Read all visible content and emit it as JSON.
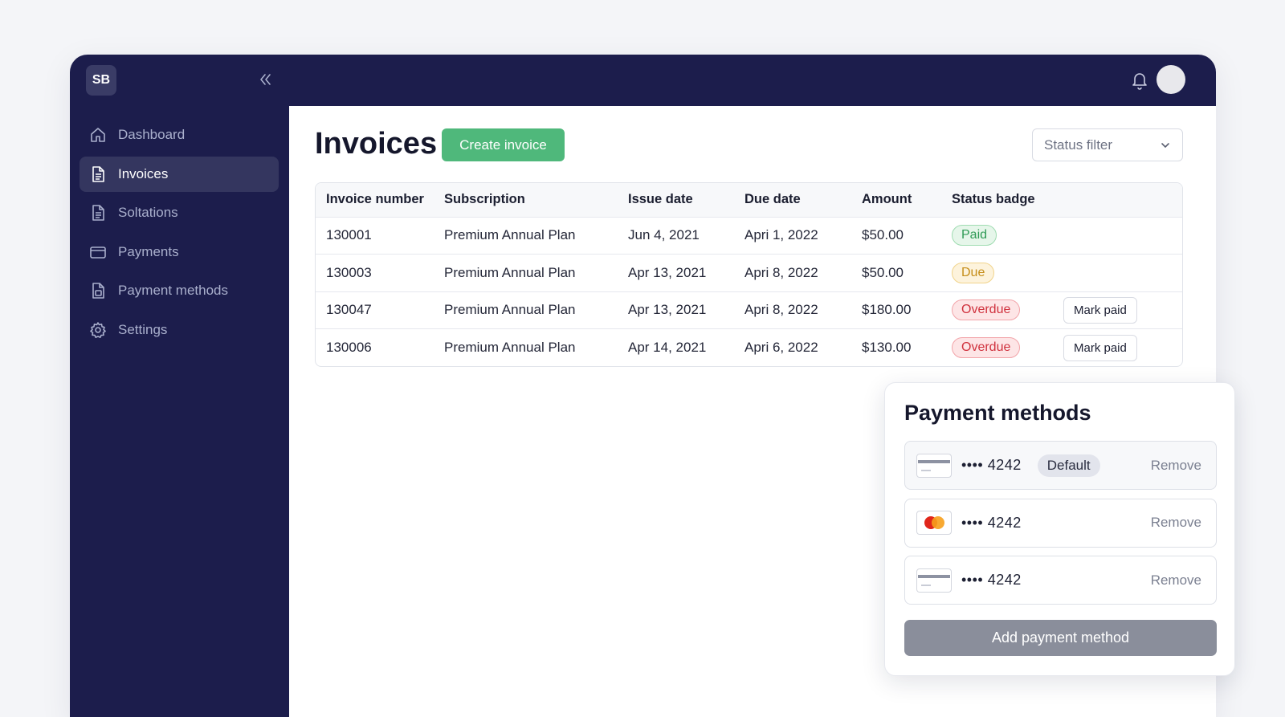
{
  "brand": {
    "initials": "SB"
  },
  "sidebar": {
    "items": [
      {
        "label": "Dashboard",
        "icon": "home-icon"
      },
      {
        "label": "Invoices",
        "icon": "document-icon",
        "active": true
      },
      {
        "label": "Soltations",
        "icon": "document-icon"
      },
      {
        "label": "Payments",
        "icon": "credit-card-icon"
      },
      {
        "label": "Payment methods",
        "icon": "document-icon"
      },
      {
        "label": "Settings",
        "icon": "gear-icon"
      }
    ]
  },
  "header": {
    "title": "Invoices",
    "create_label": "Create invoice",
    "status_filter_placeholder": "Status filter"
  },
  "table": {
    "columns": [
      "Invoice number",
      "Subscription",
      "Issue date",
      "Due date",
      "Amount",
      "Status badge"
    ],
    "rows": [
      {
        "number": "130001",
        "subscription": "Premium Annual Plan",
        "issue": "Jun 4, 2021",
        "due": "Apri 1, 2022",
        "amount": "$50.00",
        "status": "Paid",
        "action": ""
      },
      {
        "number": "130003",
        "subscription": "Premium Annual Plan",
        "issue": "Apr 13, 2021",
        "due": "Apri 8, 2022",
        "amount": "$50.00",
        "status": "Due",
        "action": ""
      },
      {
        "number": "130047",
        "subscription": "Premium Annual Plan",
        "issue": "Apr 13, 2021",
        "due": "Apri 8, 2022",
        "amount": "$180.00",
        "status": "Overdue",
        "action": "Mark paid"
      },
      {
        "number": "130006",
        "subscription": "Premium Annual Plan",
        "issue": "Apr 14, 2021",
        "due": "Apri 6, 2022",
        "amount": "$130.00",
        "status": "Overdue",
        "action": "Mark paid"
      }
    ]
  },
  "payment_methods": {
    "title": "Payment methods",
    "items": [
      {
        "masked": "•••• 4242",
        "brand_icon": "generic-card-icon",
        "default_label": "Default",
        "remove_label": "Remove"
      },
      {
        "masked": "•••• 4242",
        "brand_icon": "mastercard-icon",
        "default_label": "",
        "remove_label": "Remove"
      },
      {
        "masked": "•••• 4242",
        "brand_icon": "generic-card-icon",
        "default_label": "",
        "remove_label": "Remove"
      }
    ],
    "add_label": "Add payment method"
  },
  "colors": {
    "sidebar_bg": "#1c1d4c",
    "accent_green": "#4fb87b",
    "paid": "#2e9a55",
    "due": "#c58d18",
    "overdue": "#d0323e"
  }
}
